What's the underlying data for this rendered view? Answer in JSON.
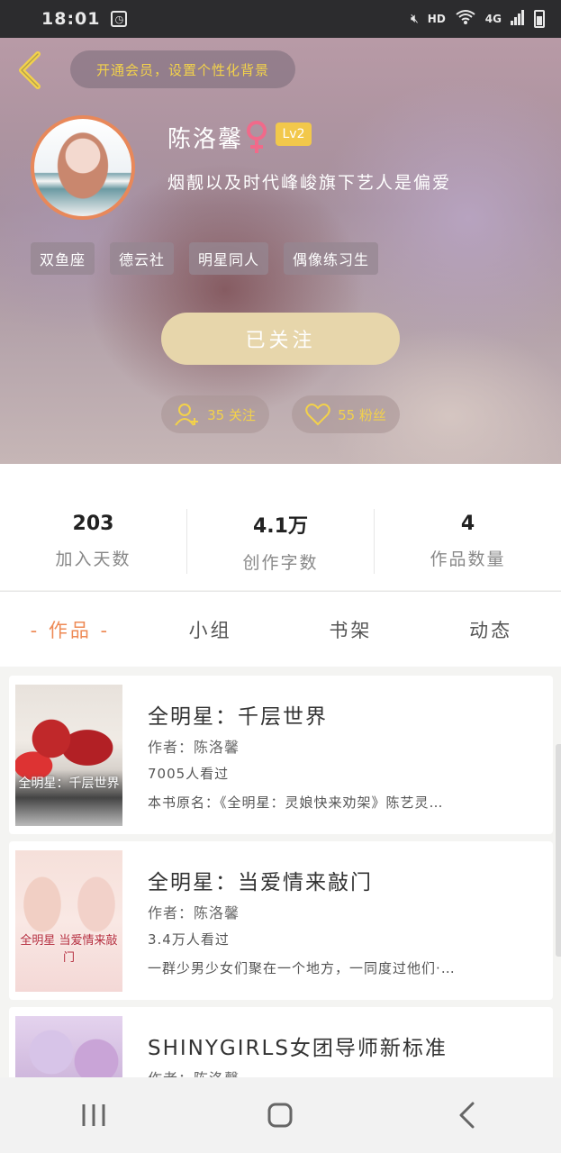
{
  "status_bar": {
    "time": "18:01",
    "network": "HD",
    "signal": "4G"
  },
  "header": {
    "vip_banner": "开通会员，设置个性化背景"
  },
  "profile": {
    "name": "陈洛馨",
    "level": "Lv2",
    "bio": "烟靓以及时代峰峻旗下艺人是偏爱",
    "tags": [
      "双鱼座",
      "德云社",
      "明星同人",
      "偶像练习生"
    ],
    "follow_button": "已关注",
    "following": "35 关注",
    "fans": "55 粉丝"
  },
  "stats": [
    {
      "value": "203",
      "label": "加入天数"
    },
    {
      "value": "4.1万",
      "label": "创作字数"
    },
    {
      "value": "4",
      "label": "作品数量"
    }
  ],
  "tabs": [
    "- 作品 -",
    "小组",
    "书架",
    "动态"
  ],
  "books": [
    {
      "title": "全明星：千层世界",
      "author": "作者：陈洛馨",
      "views": "7005人看过",
      "desc": "本书原名：《全明星：灵娘快来劝架》陈艺灵…",
      "cover_text": "全明星：千层世界"
    },
    {
      "title": "全明星：当爱情来敲门",
      "author": "作者：陈洛馨",
      "views": "3.4万人看过",
      "desc": "一群少男少女们聚在一个地方，一同度过他们·…",
      "cover_text": "全明星 当爱情来敲门"
    },
    {
      "title": "SHINYGIRLS女团导师新标准",
      "author": "作者：陈洛馨"
    }
  ],
  "colors": {
    "accent": "#ee8a55",
    "gold": "#f3d24a",
    "button": "#e7d6ab"
  }
}
